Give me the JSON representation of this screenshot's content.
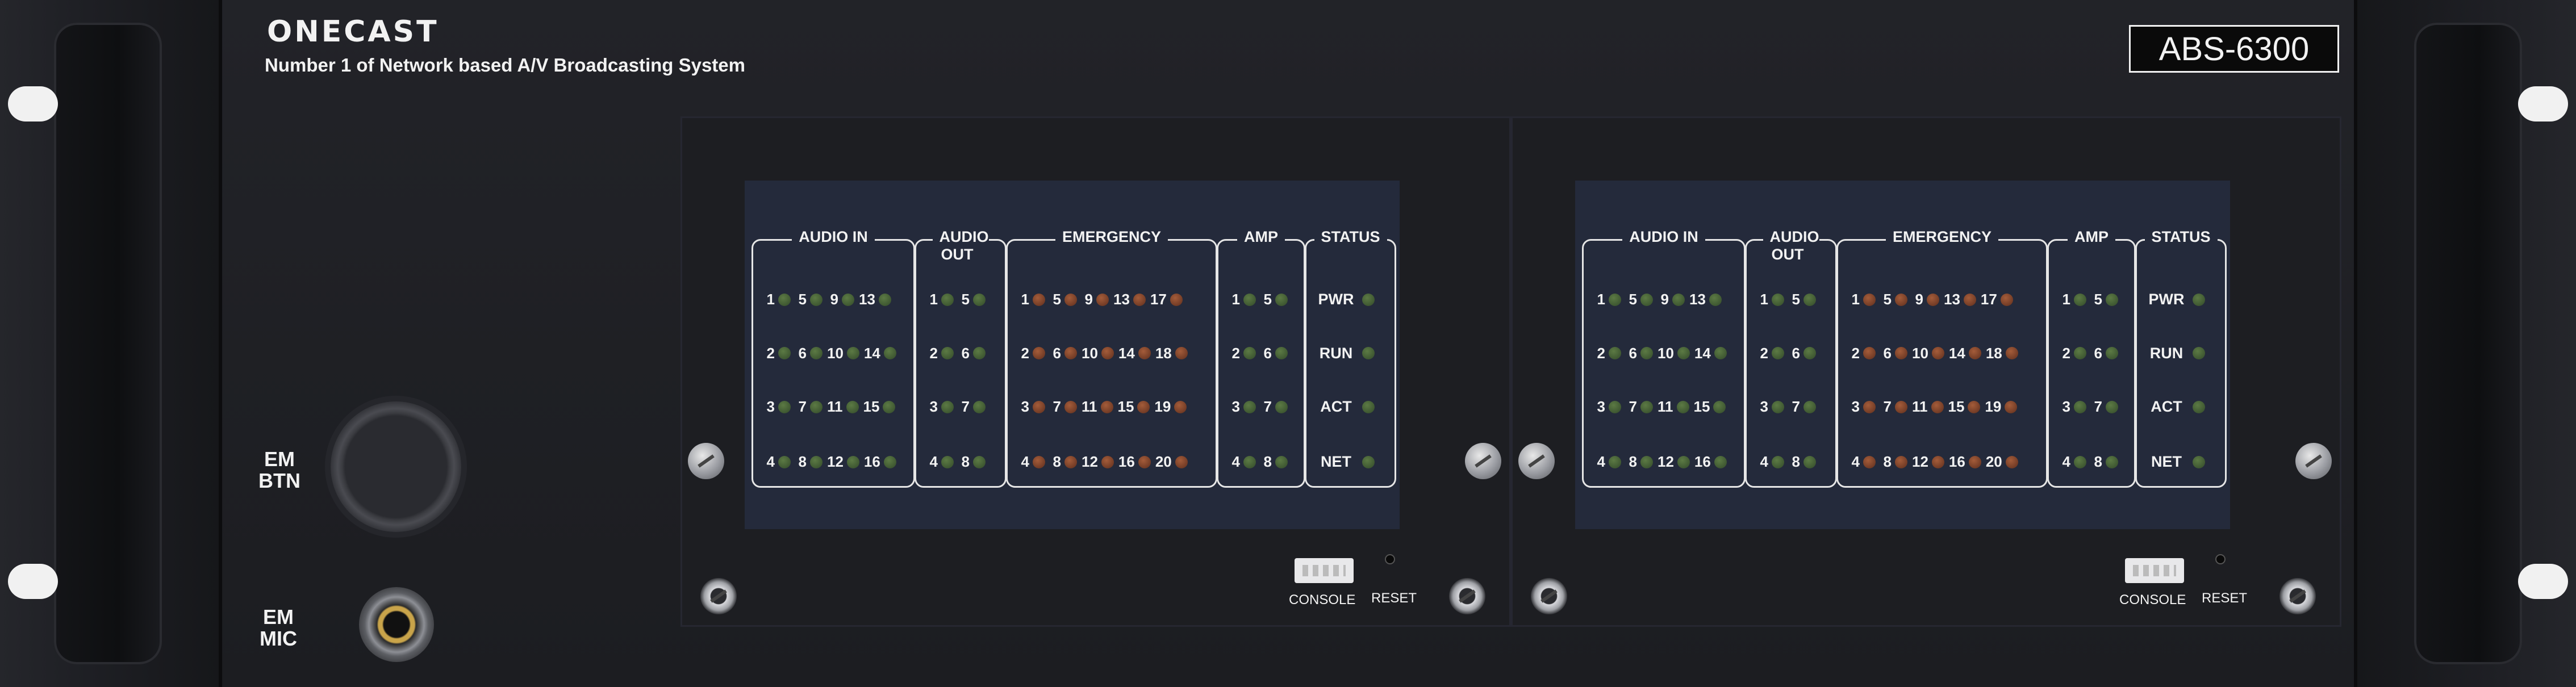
{
  "brand": {
    "logo": "ONECAST",
    "tagline": "Number 1 of Network based A/V Broadcasting System"
  },
  "model": "ABS-6300",
  "front_controls": {
    "em_btn_label": "EM\nBTN",
    "em_mic_label": "EM\nMIC"
  },
  "colors": {
    "led_green": "#46663a",
    "led_red": "#8a4a2c",
    "screen_bg": "#242a3b",
    "faceplate": "#1f2024"
  },
  "modules": [
    {
      "groups": [
        {
          "title": "AUDIO IN",
          "type": "grid",
          "led": "green",
          "rows": [
            [
              "1",
              "5",
              "9",
              "13"
            ],
            [
              "2",
              "6",
              "10",
              "14"
            ],
            [
              "3",
              "7",
              "11",
              "15"
            ],
            [
              "4",
              "8",
              "12",
              "16"
            ]
          ]
        },
        {
          "title": "AUDIO OUT",
          "type": "grid",
          "led": "green",
          "rows": [
            [
              "1",
              "5"
            ],
            [
              "2",
              "6"
            ],
            [
              "3",
              "7"
            ],
            [
              "4",
              "8"
            ]
          ]
        },
        {
          "title": "EMERGENCY",
          "type": "grid",
          "led": "red",
          "rows": [
            [
              "1",
              "5",
              "9",
              "13",
              "17"
            ],
            [
              "2",
              "6",
              "10",
              "14",
              "18"
            ],
            [
              "3",
              "7",
              "11",
              "15",
              "19"
            ],
            [
              "4",
              "8",
              "12",
              "16",
              "20"
            ]
          ]
        },
        {
          "title": "AMP",
          "type": "grid",
          "led": "green",
          "rows": [
            [
              "1",
              "5"
            ],
            [
              "2",
              "6"
            ],
            [
              "3",
              "7"
            ],
            [
              "4",
              "8"
            ]
          ]
        },
        {
          "title": "STATUS",
          "type": "status",
          "led": "green",
          "items": [
            "PWR",
            "RUN",
            "ACT",
            "NET"
          ]
        }
      ],
      "console_label": "CONSOLE",
      "reset_label": "RESET"
    },
    {
      "groups": [
        {
          "title": "AUDIO IN",
          "type": "grid",
          "led": "green",
          "rows": [
            [
              "1",
              "5",
              "9",
              "13"
            ],
            [
              "2",
              "6",
              "10",
              "14"
            ],
            [
              "3",
              "7",
              "11",
              "15"
            ],
            [
              "4",
              "8",
              "12",
              "16"
            ]
          ]
        },
        {
          "title": "AUDIO OUT",
          "type": "grid",
          "led": "green",
          "rows": [
            [
              "1",
              "5"
            ],
            [
              "2",
              "6"
            ],
            [
              "3",
              "7"
            ],
            [
              "4",
              "8"
            ]
          ]
        },
        {
          "title": "EMERGENCY",
          "type": "grid",
          "led": "red",
          "rows": [
            [
              "1",
              "5",
              "9",
              "13",
              "17"
            ],
            [
              "2",
              "6",
              "10",
              "14",
              "18"
            ],
            [
              "3",
              "7",
              "11",
              "15",
              "19"
            ],
            [
              "4",
              "8",
              "12",
              "16",
              "20"
            ]
          ]
        },
        {
          "title": "AMP",
          "type": "grid",
          "led": "green",
          "rows": [
            [
              "1",
              "5"
            ],
            [
              "2",
              "6"
            ],
            [
              "3",
              "7"
            ],
            [
              "4",
              "8"
            ]
          ]
        },
        {
          "title": "STATUS",
          "type": "status",
          "led": "green",
          "items": [
            "PWR",
            "RUN",
            "ACT",
            "NET"
          ]
        }
      ],
      "console_label": "CONSOLE",
      "reset_label": "RESET"
    }
  ]
}
